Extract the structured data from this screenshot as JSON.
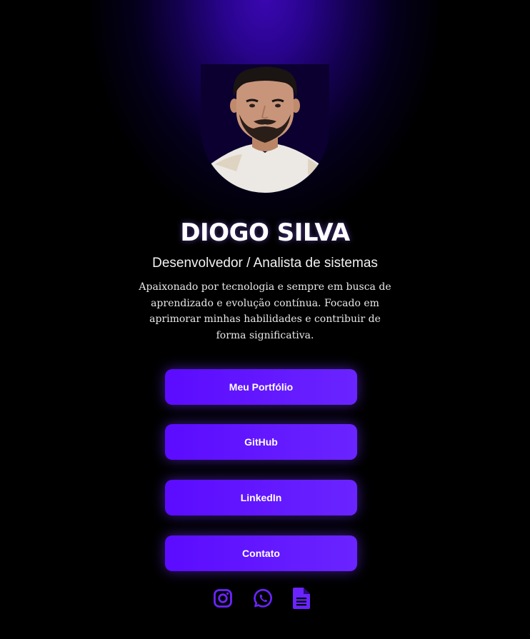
{
  "profile": {
    "name": "DIOGO SILVA",
    "role": "Desenvolvedor / Analista de sistemas",
    "bio": "Apaixonado por tecnologia e sempre em busca de aprendizado e evolução contínua. Focado em aprimorar minhas habilidades e contribuir de forma significativa."
  },
  "links": [
    {
      "label": "Meu Portfólio"
    },
    {
      "label": "GitHub"
    },
    {
      "label": "LinkedIn"
    },
    {
      "label": "Contato"
    }
  ],
  "socials": [
    {
      "icon": "instagram-icon"
    },
    {
      "icon": "whatsapp-icon"
    },
    {
      "icon": "document-icon"
    }
  ],
  "colors": {
    "background": "#000000",
    "glow": "#3a07b0",
    "accent": "#5b0bff",
    "icon": "#6a24ff",
    "text": "#ffffff"
  }
}
